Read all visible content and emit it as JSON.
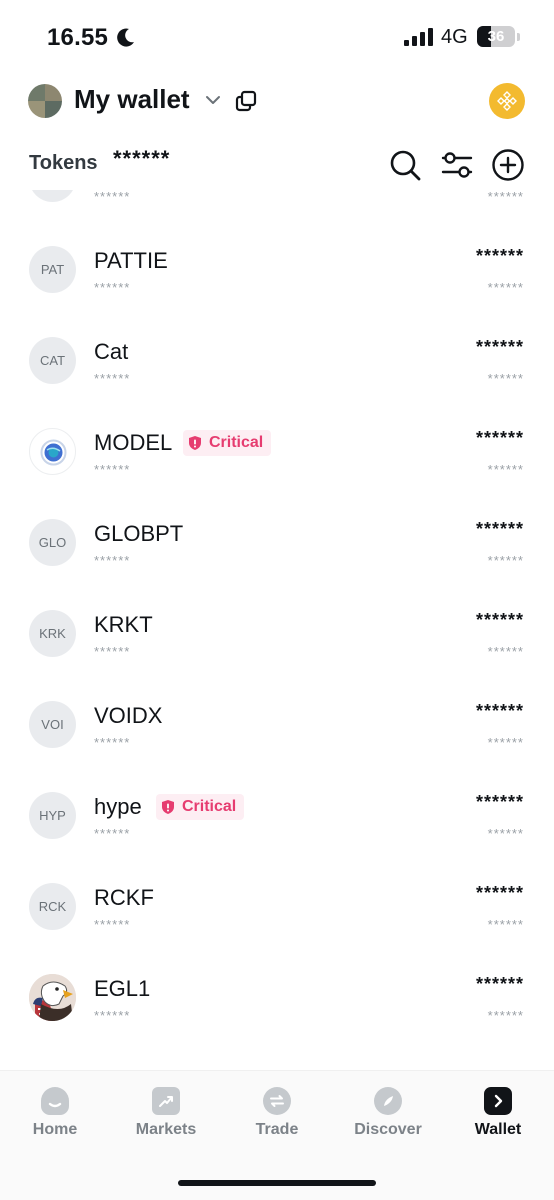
{
  "status_bar": {
    "time": "16.55",
    "network": "4G",
    "battery": "36",
    "battery_fraction": 0.36
  },
  "header": {
    "wallet_name": "My wallet"
  },
  "tokens_bar": {
    "label": "Tokens",
    "total": "******"
  },
  "tokens": [
    {
      "symbol": "",
      "name": "",
      "badge": "",
      "balance": "",
      "sub": "******",
      "value": "******",
      "icon": "blank"
    },
    {
      "symbol": "PAT",
      "name": "PATTIE",
      "badge": "",
      "balance": "******",
      "sub": "******",
      "value": "******",
      "icon": "text"
    },
    {
      "symbol": "CAT",
      "name": "Cat",
      "badge": "",
      "balance": "******",
      "sub": "******",
      "value": "******",
      "icon": "text"
    },
    {
      "symbol": "",
      "name": "MODEL",
      "badge": "Critical",
      "balance": "******",
      "sub": "******",
      "value": "******",
      "icon": "globe"
    },
    {
      "symbol": "GLO",
      "name": "GLOBPT",
      "badge": "",
      "balance": "******",
      "sub": "******",
      "value": "******",
      "icon": "text"
    },
    {
      "symbol": "KRK",
      "name": "KRKT",
      "badge": "",
      "balance": "******",
      "sub": "******",
      "value": "******",
      "icon": "text"
    },
    {
      "symbol": "VOI",
      "name": "VOIDX",
      "badge": "",
      "balance": "******",
      "sub": "******",
      "value": "******",
      "icon": "text"
    },
    {
      "symbol": "HYP",
      "name": "hype",
      "badge": "Critical",
      "balance": "******",
      "sub": "******",
      "value": "******",
      "icon": "text"
    },
    {
      "symbol": "RCK",
      "name": "RCKF",
      "badge": "",
      "balance": "******",
      "sub": "******",
      "value": "******",
      "icon": "text"
    },
    {
      "symbol": "",
      "name": "EGL1",
      "badge": "",
      "balance": "******",
      "sub": "******",
      "value": "******",
      "icon": "eagle"
    }
  ],
  "nav": [
    {
      "label": "Home",
      "icon": "home-icon",
      "active": false
    },
    {
      "label": "Markets",
      "icon": "markets-icon",
      "active": false
    },
    {
      "label": "Trade",
      "icon": "trade-icon",
      "active": false
    },
    {
      "label": "Discover",
      "icon": "discover-icon",
      "active": false
    },
    {
      "label": "Wallet",
      "icon": "wallet-icon",
      "active": true
    }
  ],
  "colors": {
    "critical": "#e63c70",
    "critical_bg": "#fdeef3",
    "exchange": "#f3ba2f",
    "text": "#111418",
    "muted": "#9aa0a6"
  }
}
